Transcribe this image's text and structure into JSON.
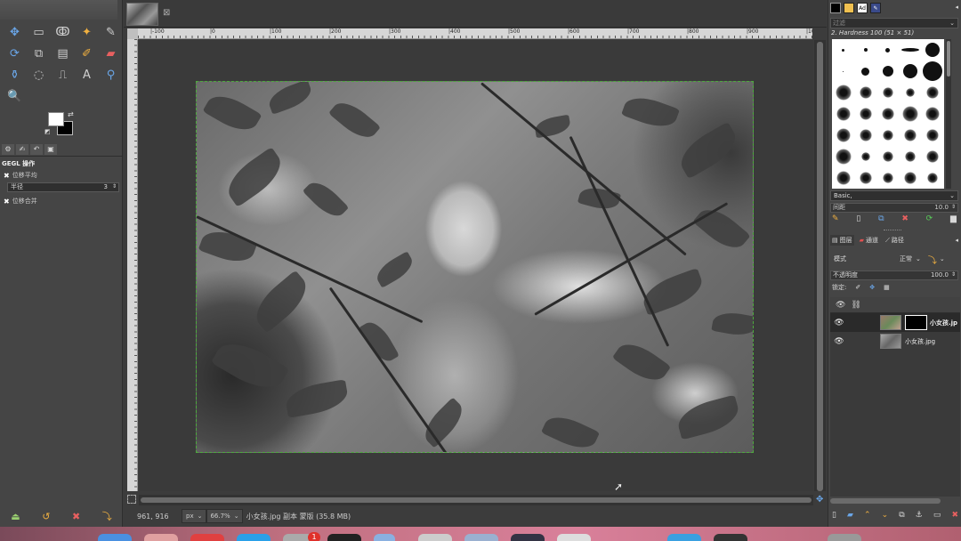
{
  "toolbox": {
    "tools": [
      {
        "icon": "move-icon",
        "glyph": "✥",
        "tone": "blue"
      },
      {
        "icon": "rect-select-icon",
        "glyph": "▭",
        "tone": ""
      },
      {
        "icon": "lasso-icon",
        "glyph": "ↂ",
        "tone": ""
      },
      {
        "icon": "fuzzy-select-icon",
        "glyph": "✦",
        "tone": "orange"
      },
      {
        "icon": "paths-icon",
        "glyph": "✎",
        "tone": ""
      },
      {
        "icon": "transform-icon",
        "glyph": "⟳",
        "tone": "blue"
      },
      {
        "icon": "crop-icon",
        "glyph": "⧉",
        "tone": ""
      },
      {
        "icon": "gradient-icon",
        "glyph": "▤",
        "tone": ""
      },
      {
        "icon": "paintbrush-icon",
        "glyph": "✐",
        "tone": "orange"
      },
      {
        "icon": "eraser-icon",
        "glyph": "▰",
        "tone": "red"
      },
      {
        "icon": "clone-icon",
        "glyph": "⚱",
        "tone": "blue"
      },
      {
        "icon": "smudge-icon",
        "glyph": "◌",
        "tone": ""
      },
      {
        "icon": "dodge-burn-icon",
        "glyph": "⎍",
        "tone": ""
      },
      {
        "icon": "text-icon",
        "glyph": "A",
        "tone": ""
      },
      {
        "icon": "color-picker-icon",
        "glyph": "⚲",
        "tone": "blue"
      },
      {
        "icon": "zoom-icon",
        "glyph": "🔍",
        "tone": "blue"
      }
    ],
    "panel_title": "GEGL 操作",
    "option_1": "位移平均",
    "radius_label": "半径",
    "radius_value": "3",
    "option_2": "位移合并"
  },
  "canvas": {
    "ruler_labels": [
      "|-100",
      "|0",
      "|100",
      "|200",
      "|300",
      "|400",
      "|500",
      "|600",
      "|700",
      "|800",
      "|900",
      "|1000",
      "|1100"
    ]
  },
  "status": {
    "coords": "961, 916",
    "unit": "px",
    "zoom": "66.7%",
    "text": "小女孩.jpg 副本 蒙版 (35.8 MB)"
  },
  "brushes": {
    "filter_placeholder": "过滤",
    "current": "2. Hardness 100 (51 × 51)",
    "set": "Basic,",
    "spacing_label": "间距",
    "spacing_value": "10.0"
  },
  "layers_panel": {
    "tabs": [
      "图层",
      "通道",
      "路径"
    ],
    "mode_label": "模式",
    "mode_value": "正常",
    "opacity_label": "不透明度",
    "opacity_value": "100.0",
    "lock_label": "锁定:",
    "layers": [
      {
        "name": "小女孩.jp",
        "selected": true,
        "has_mask": true
      },
      {
        "name": "小女孩.jpg",
        "selected": false,
        "has_mask": false
      }
    ]
  },
  "dock": {
    "notification_badge": "1"
  }
}
